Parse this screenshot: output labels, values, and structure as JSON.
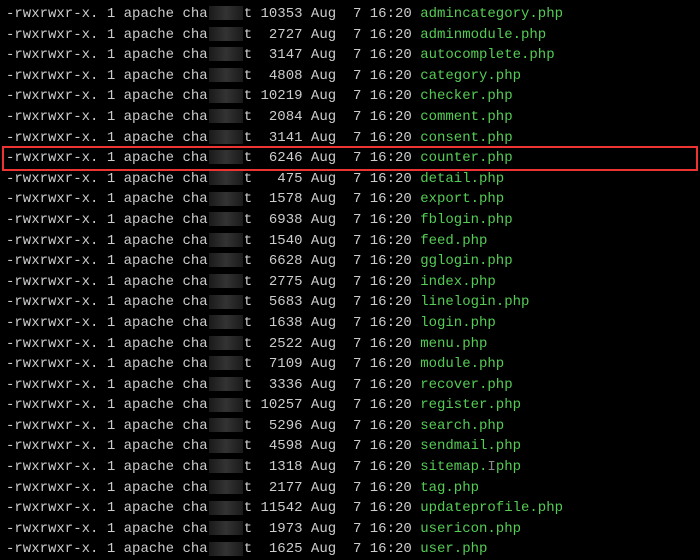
{
  "rows": [
    {
      "perms": "-rwxrwxr-x.",
      "links": "1",
      "owner": "apache",
      "group_vis": "cha",
      "group_suffix": "t",
      "size": "10353",
      "month": "Aug",
      "day": "7",
      "time": "16:20",
      "filename": "admincategory.php",
      "hl": false
    },
    {
      "perms": "-rwxrwxr-x.",
      "links": "1",
      "owner": "apache",
      "group_vis": "cha",
      "group_suffix": "t",
      "size": "2727",
      "month": "Aug",
      "day": "7",
      "time": "16:20",
      "filename": "adminmodule.php",
      "hl": false
    },
    {
      "perms": "-rwxrwxr-x.",
      "links": "1",
      "owner": "apache",
      "group_vis": "cha",
      "group_suffix": "t",
      "size": "3147",
      "month": "Aug",
      "day": "7",
      "time": "16:20",
      "filename": "autocomplete.php",
      "hl": false
    },
    {
      "perms": "-rwxrwxr-x.",
      "links": "1",
      "owner": "apache",
      "group_vis": "cha",
      "group_suffix": "t",
      "size": "4808",
      "month": "Aug",
      "day": "7",
      "time": "16:20",
      "filename": "category.php",
      "hl": false
    },
    {
      "perms": "-rwxrwxr-x.",
      "links": "1",
      "owner": "apache",
      "group_vis": "cha",
      "group_suffix": "t",
      "size": "10219",
      "month": "Aug",
      "day": "7",
      "time": "16:20",
      "filename": "checker.php",
      "hl": false
    },
    {
      "perms": "-rwxrwxr-x.",
      "links": "1",
      "owner": "apache",
      "group_vis": "cha",
      "group_suffix": "t",
      "size": "2084",
      "month": "Aug",
      "day": "7",
      "time": "16:20",
      "filename": "comment.php",
      "hl": false
    },
    {
      "perms": "-rwxrwxr-x.",
      "links": "1",
      "owner": "apache",
      "group_vis": "cha",
      "group_suffix": "t",
      "size": "3141",
      "month": "Aug",
      "day": "7",
      "time": "16:20",
      "filename": "consent.php",
      "hl": false
    },
    {
      "perms": "-rwxrwxr-x.",
      "links": "1",
      "owner": "apache",
      "group_vis": "cha",
      "group_suffix": "t",
      "size": "6246",
      "month": "Aug",
      "day": "7",
      "time": "16:20",
      "filename": "counter.php",
      "hl": true
    },
    {
      "perms": "-rwxrwxr-x.",
      "links": "1",
      "owner": "apache",
      "group_vis": "cha",
      "group_suffix": "t",
      "size": "475",
      "month": "Aug",
      "day": "7",
      "time": "16:20",
      "filename": "detail.php",
      "hl": false
    },
    {
      "perms": "-rwxrwxr-x.",
      "links": "1",
      "owner": "apache",
      "group_vis": "cha",
      "group_suffix": "t",
      "size": "1578",
      "month": "Aug",
      "day": "7",
      "time": "16:20",
      "filename": "export.php",
      "hl": false
    },
    {
      "perms": "-rwxrwxr-x.",
      "links": "1",
      "owner": "apache",
      "group_vis": "cha",
      "group_suffix": "t",
      "size": "6938",
      "month": "Aug",
      "day": "7",
      "time": "16:20",
      "filename": "fblogin.php",
      "hl": false
    },
    {
      "perms": "-rwxrwxr-x.",
      "links": "1",
      "owner": "apache",
      "group_vis": "cha",
      "group_suffix": "t",
      "size": "1540",
      "month": "Aug",
      "day": "7",
      "time": "16:20",
      "filename": "feed.php",
      "hl": false
    },
    {
      "perms": "-rwxrwxr-x.",
      "links": "1",
      "owner": "apache",
      "group_vis": "cha",
      "group_suffix": "t",
      "size": "6628",
      "month": "Aug",
      "day": "7",
      "time": "16:20",
      "filename": "gglogin.php",
      "hl": false
    },
    {
      "perms": "-rwxrwxr-x.",
      "links": "1",
      "owner": "apache",
      "group_vis": "cha",
      "group_suffix": "t",
      "size": "2775",
      "month": "Aug",
      "day": "7",
      "time": "16:20",
      "filename": "index.php",
      "hl": false
    },
    {
      "perms": "-rwxrwxr-x.",
      "links": "1",
      "owner": "apache",
      "group_vis": "cha",
      "group_suffix": "t",
      "size": "5683",
      "month": "Aug",
      "day": "7",
      "time": "16:20",
      "filename": "linelogin.php",
      "hl": false
    },
    {
      "perms": "-rwxrwxr-x.",
      "links": "1",
      "owner": "apache",
      "group_vis": "cha",
      "group_suffix": "t",
      "size": "1638",
      "month": "Aug",
      "day": "7",
      "time": "16:20",
      "filename": "login.php",
      "hl": false
    },
    {
      "perms": "-rwxrwxr-x.",
      "links": "1",
      "owner": "apache",
      "group_vis": "cha",
      "group_suffix": "t",
      "size": "2522",
      "month": "Aug",
      "day": "7",
      "time": "16:20",
      "filename": "menu.php",
      "hl": false
    },
    {
      "perms": "-rwxrwxr-x.",
      "links": "1",
      "owner": "apache",
      "group_vis": "cha",
      "group_suffix": "t",
      "size": "7109",
      "month": "Aug",
      "day": "7",
      "time": "16:20",
      "filename": "module.php",
      "hl": false
    },
    {
      "perms": "-rwxrwxr-x.",
      "links": "1",
      "owner": "apache",
      "group_vis": "cha",
      "group_suffix": "t",
      "size": "3336",
      "month": "Aug",
      "day": "7",
      "time": "16:20",
      "filename": "recover.php",
      "hl": false
    },
    {
      "perms": "-rwxrwxr-x.",
      "links": "1",
      "owner": "apache",
      "group_vis": "cha",
      "group_suffix": "t",
      "size": "10257",
      "month": "Aug",
      "day": "7",
      "time": "16:20",
      "filename": "register.php",
      "hl": false
    },
    {
      "perms": "-rwxrwxr-x.",
      "links": "1",
      "owner": "apache",
      "group_vis": "cha",
      "group_suffix": "t",
      "size": "5296",
      "month": "Aug",
      "day": "7",
      "time": "16:20",
      "filename": "search.php",
      "hl": false
    },
    {
      "perms": "-rwxrwxr-x.",
      "links": "1",
      "owner": "apache",
      "group_vis": "cha",
      "group_suffix": "t",
      "size": "4598",
      "month": "Aug",
      "day": "7",
      "time": "16:20",
      "filename": "sendmail.php",
      "hl": false
    },
    {
      "perms": "-rwxrwxr-x.",
      "links": "1",
      "owner": "apache",
      "group_vis": "cha",
      "group_suffix": "t",
      "size": "1318",
      "month": "Aug",
      "day": "7",
      "time": "16:20",
      "filename": "sitemap.php",
      "hl": false,
      "cursor": true
    },
    {
      "perms": "-rwxrwxr-x.",
      "links": "1",
      "owner": "apache",
      "group_vis": "cha",
      "group_suffix": "t",
      "size": "2177",
      "month": "Aug",
      "day": "7",
      "time": "16:20",
      "filename": "tag.php",
      "hl": false
    },
    {
      "perms": "-rwxrwxr-x.",
      "links": "1",
      "owner": "apache",
      "group_vis": "cha",
      "group_suffix": "t",
      "size": "11542",
      "month": "Aug",
      "day": "7",
      "time": "16:20",
      "filename": "updateprofile.php",
      "hl": false
    },
    {
      "perms": "-rwxrwxr-x.",
      "links": "1",
      "owner": "apache",
      "group_vis": "cha",
      "group_suffix": "t",
      "size": "1973",
      "month": "Aug",
      "day": "7",
      "time": "16:20",
      "filename": "usericon.php",
      "hl": false
    },
    {
      "perms": "-rwxrwxr-x.",
      "links": "1",
      "owner": "apache",
      "group_vis": "cha",
      "group_suffix": "t",
      "size": "1625",
      "month": "Aug",
      "day": "7",
      "time": "16:20",
      "filename": "user.php",
      "hl": false
    }
  ]
}
